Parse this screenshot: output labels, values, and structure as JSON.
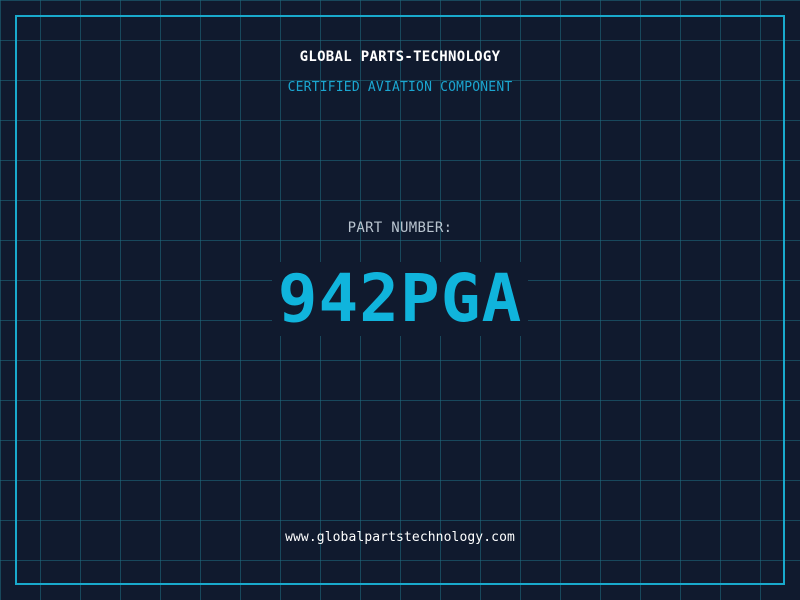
{
  "header": {
    "company_name": "GLOBAL PARTS-TECHNOLOGY",
    "subtitle": "CERTIFIED AVIATION COMPONENT"
  },
  "part": {
    "label": "PART NUMBER:",
    "number": "942PGA"
  },
  "footer": {
    "website": "www.globalpartstechnology.com"
  },
  "colors": {
    "background": "#101a2e",
    "grid": "#1f6e82",
    "frame": "#19a9cc",
    "accent": "#10b4dc",
    "title_text": "#ffffff",
    "label_text": "#b9c4cf"
  }
}
